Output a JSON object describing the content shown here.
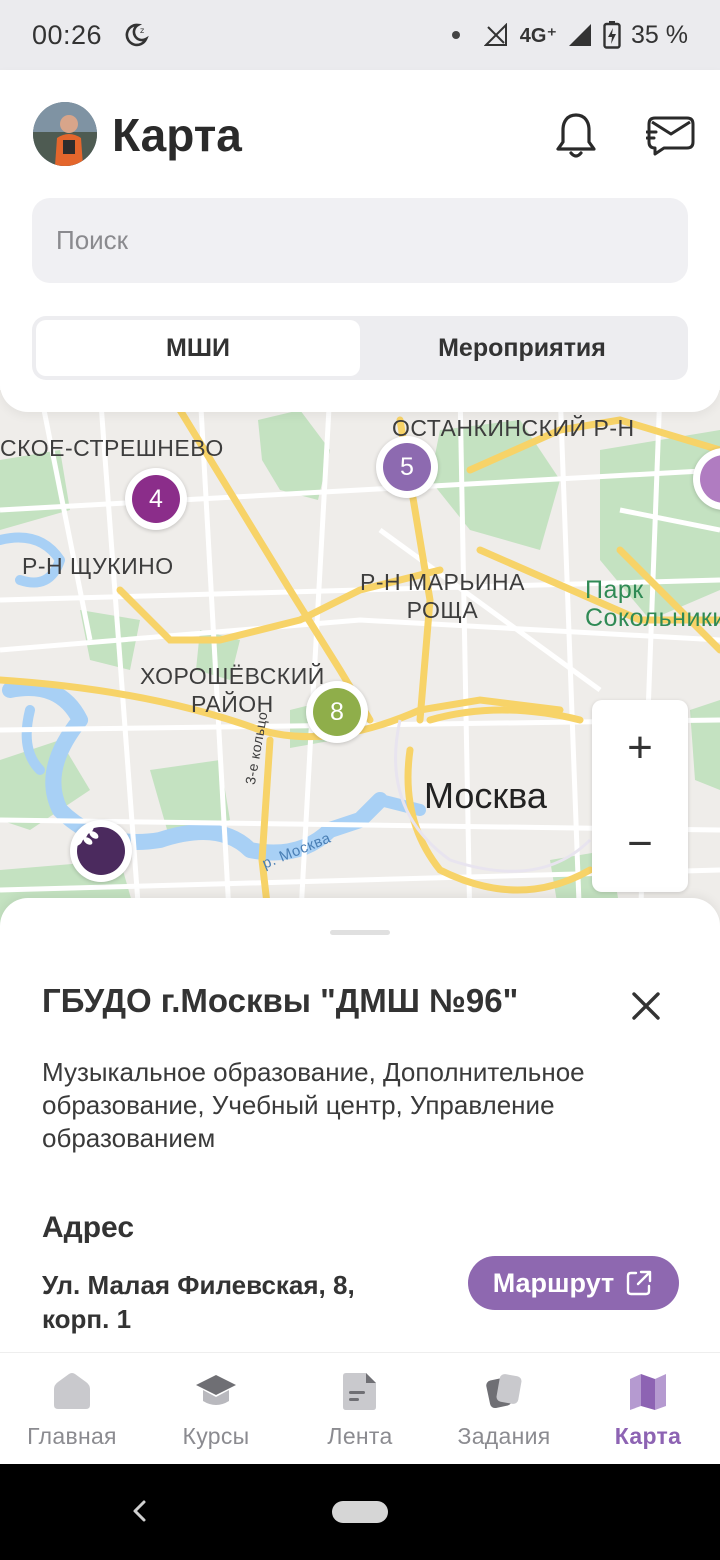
{
  "status_bar": {
    "time": "00:26",
    "network": "4G⁺",
    "battery": "35 %"
  },
  "header": {
    "title": "Карта"
  },
  "search": {
    "placeholder": "Поиск"
  },
  "segments": [
    {
      "label": "МШИ",
      "active": true
    },
    {
      "label": "Мероприятия",
      "active": false
    }
  ],
  "map": {
    "labels": {
      "streshnevo": "СКОЕ-СТРЕШНЕВО",
      "ostankino": "ОСТАНКИНСКИЙ Р-Н",
      "shchukino": "Р-Н ЩУКИНО",
      "marina_roshcha": "Р-Н МАРЬИНА\nРОЩА",
      "park": "Парк\nСокольники",
      "khoroshevsky": "ХОРОШЁВСКИЙ\nРАЙОН",
      "moscow": "Москва",
      "ring": "3-е кольцо",
      "river": "р. Москва"
    },
    "clusters": [
      {
        "count": "4",
        "color": "#8b2d8a"
      },
      {
        "count": "5",
        "color": "#8d6ab0"
      },
      {
        "count": "8",
        "color": "#8fae4a"
      }
    ],
    "zoom_in": "+",
    "zoom_out": "−"
  },
  "sheet": {
    "name": "ГБУДО г.Москвы \"ДМШ №96\"",
    "description": "Музыкальное образование, Дополнительное образование, Учебный центр, Управление образованием",
    "address_title": "Адрес",
    "address": "Ул. Малая Филевская, 8, корп. 1",
    "route_label": "Маршрут"
  },
  "nav": [
    {
      "label": "Главная",
      "icon": "home-icon",
      "active": false
    },
    {
      "label": "Курсы",
      "icon": "graduation-cap-icon",
      "active": false
    },
    {
      "label": "Лента",
      "icon": "feed-icon",
      "active": false
    },
    {
      "label": "Задания",
      "icon": "tasks-icon",
      "active": false
    },
    {
      "label": "Карта",
      "icon": "map-icon",
      "active": true
    }
  ],
  "colors": {
    "accent": "#8e68b0",
    "map_park": "#c4e2c1",
    "map_road": "#f7d368",
    "map_water": "#a8d0f5"
  }
}
